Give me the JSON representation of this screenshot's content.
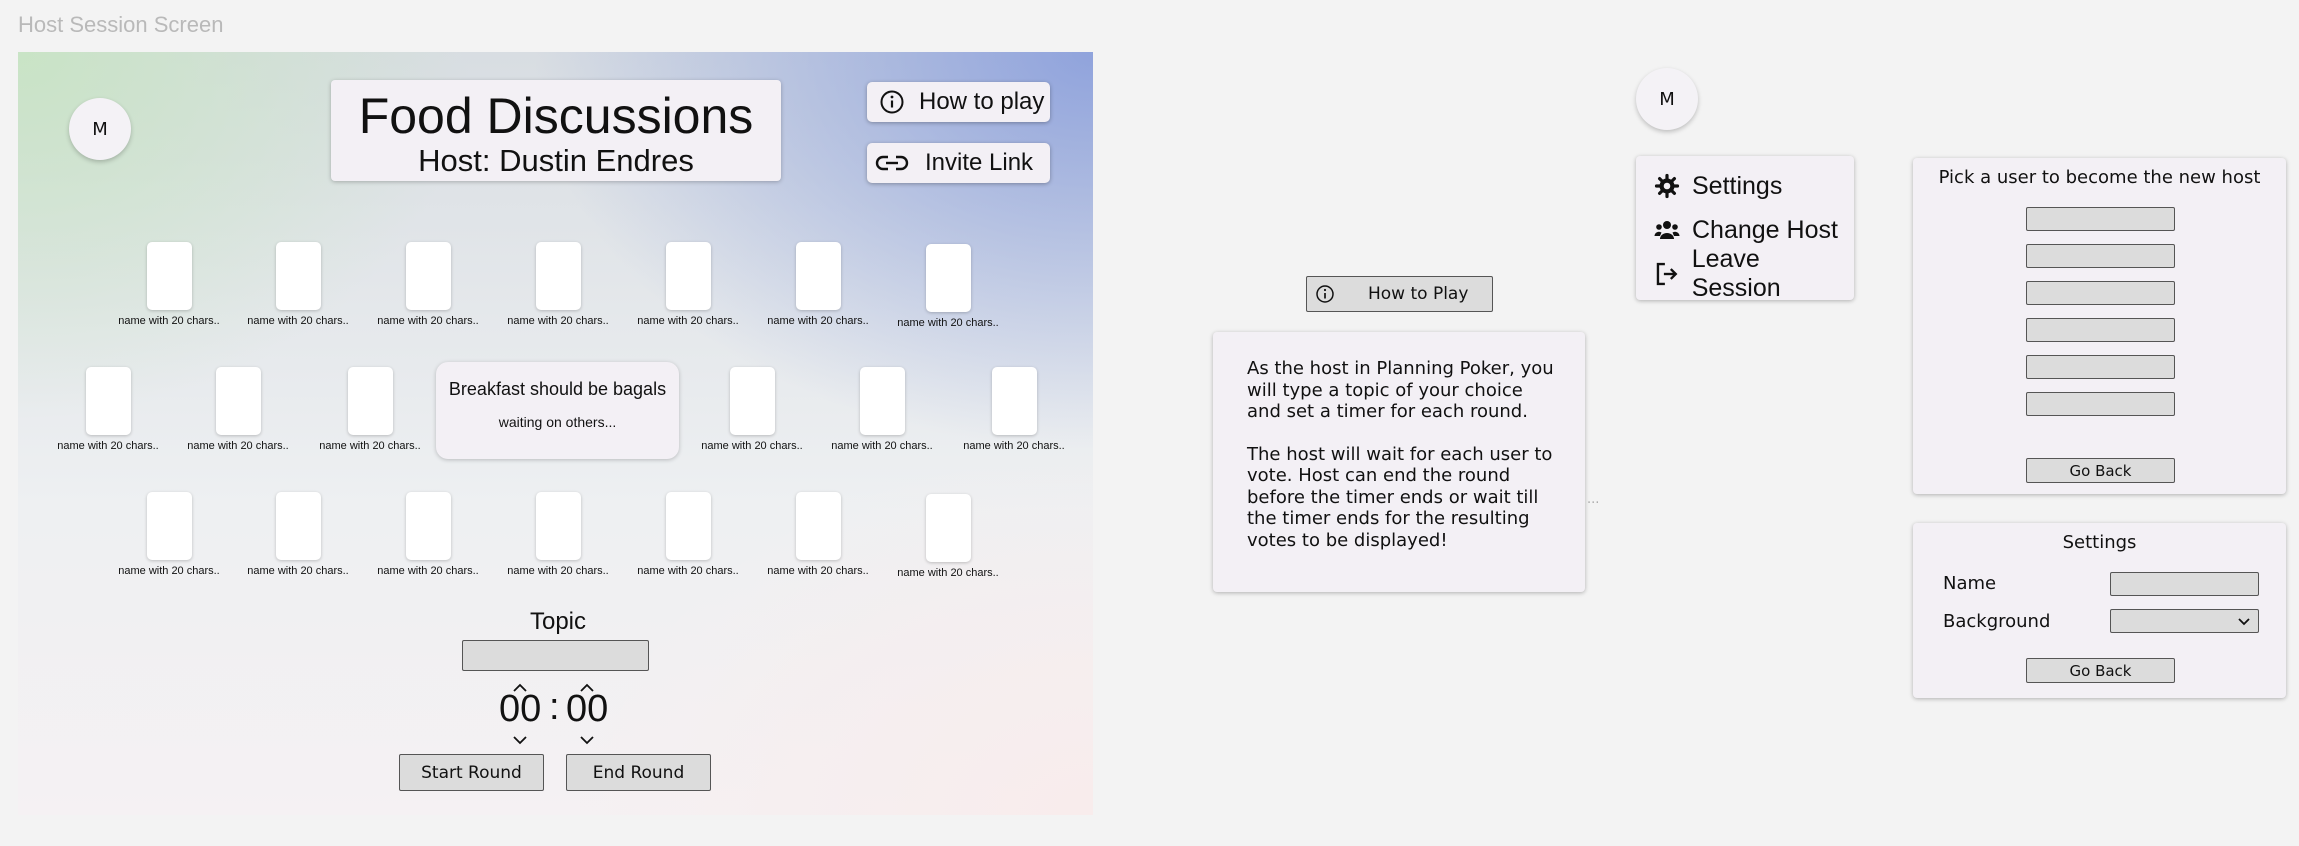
{
  "screen_label": "Host Session Screen",
  "session": {
    "avatar_initial": "M",
    "title": "Food Discussions",
    "host": "Host: Dustin Endres",
    "how_to_play": "How to play",
    "invite_link": "Invite Link"
  },
  "player_card_label": "name with 20 chars..",
  "topic_card": {
    "title": "Breakfast should be bagals",
    "status": "waiting on others..."
  },
  "controls": {
    "topic_label": "Topic",
    "topic_value": "",
    "minutes": "00",
    "separator": ":",
    "seconds": "00",
    "start_round": "Start Round",
    "end_round": "End Round"
  },
  "help": {
    "button": "How to Play",
    "text_p1": "As the host in Planning Poker, you will type a topic of your choice and set a timer for each round.",
    "text_p2": "The host will wait for each user to vote. Host can end the round before the timer ends or wait till the timer ends for the resulting votes to be displayed!",
    "ellipsis": "..."
  },
  "menu": {
    "avatar_initial": "M",
    "items": [
      {
        "label": "Settings",
        "icon": "gear-icon"
      },
      {
        "label": "Change Host",
        "icon": "people-icon"
      },
      {
        "label": "Leave Session",
        "icon": "logout-icon"
      }
    ]
  },
  "change_host": {
    "title": "Pick a user to become the new host",
    "go_back": "Go Back"
  },
  "settings": {
    "title": "Settings",
    "name_label": "Name",
    "background_label": "Background",
    "go_back": "Go Back"
  }
}
